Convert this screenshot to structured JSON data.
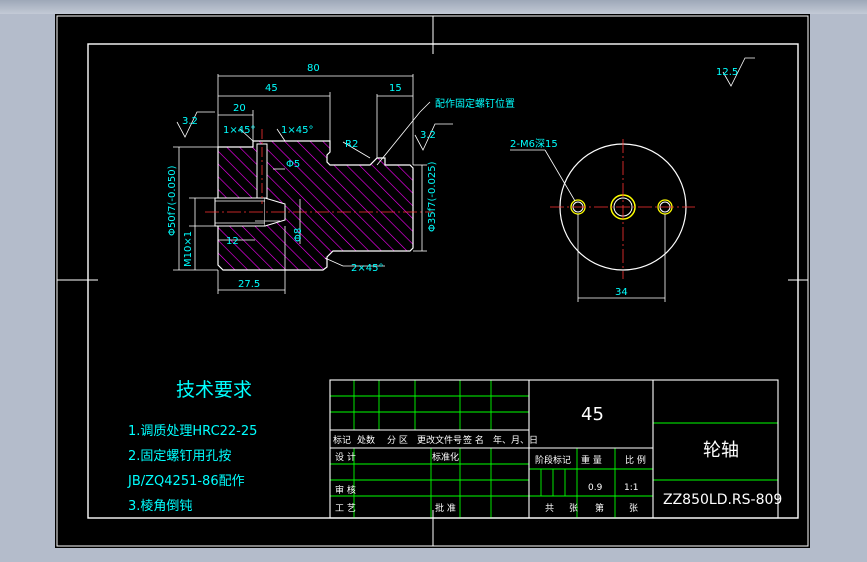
{
  "drawing": {
    "dims": {
      "d80": "80",
      "d45": "45",
      "d15": "15",
      "d20": "20",
      "d12": "12",
      "d275": "27.5",
      "d34": "34",
      "phi5": "Φ5",
      "phi8": "Φ8",
      "r2": "R2",
      "ch1a": "1×45°",
      "ch1b": "1×45°",
      "ch2": "2×45°",
      "dia50": "Φ50f7(-0.050)",
      "dia35": "Φ35f7(-0.025)",
      "m10": "M10×1",
      "rough_left": "3.2",
      "rough_right": "3.2",
      "rough_general": "12.5",
      "note_pin": "配作固定螺钉位置",
      "note_holes": "2-M6深15"
    },
    "tech": {
      "title": "技术要求",
      "items": [
        "1.调质处理HRC22-25",
        "2.固定螺钉用孔按",
        "JB/ZQ4251-86配作",
        "3.棱角倒钝"
      ]
    },
    "title_block": {
      "material": "45",
      "part_name": "轮轴",
      "drawing_no": "ZZ850LD.RS-809",
      "h_biaoji": "标记",
      "h_chushu": "处数",
      "h_fenqu": "分 区",
      "h_gengai": "更改文件号",
      "h_qianming": "签 名",
      "h_nianyue": "年、月、日",
      "r_sheji": "设 计",
      "r_biaozhunhua": "标准化",
      "r_shenhe": "审 核",
      "r_gongyi": "工 艺",
      "r_pizhun": "批 准",
      "h_jieduan": "阶段标记",
      "h_zhongliang": "重 量",
      "h_bili": "比 例",
      "weight": "0.9",
      "scale": "1:1",
      "gong": "共",
      "zhang1": "张",
      "di": "第",
      "zhang2": "张"
    }
  }
}
